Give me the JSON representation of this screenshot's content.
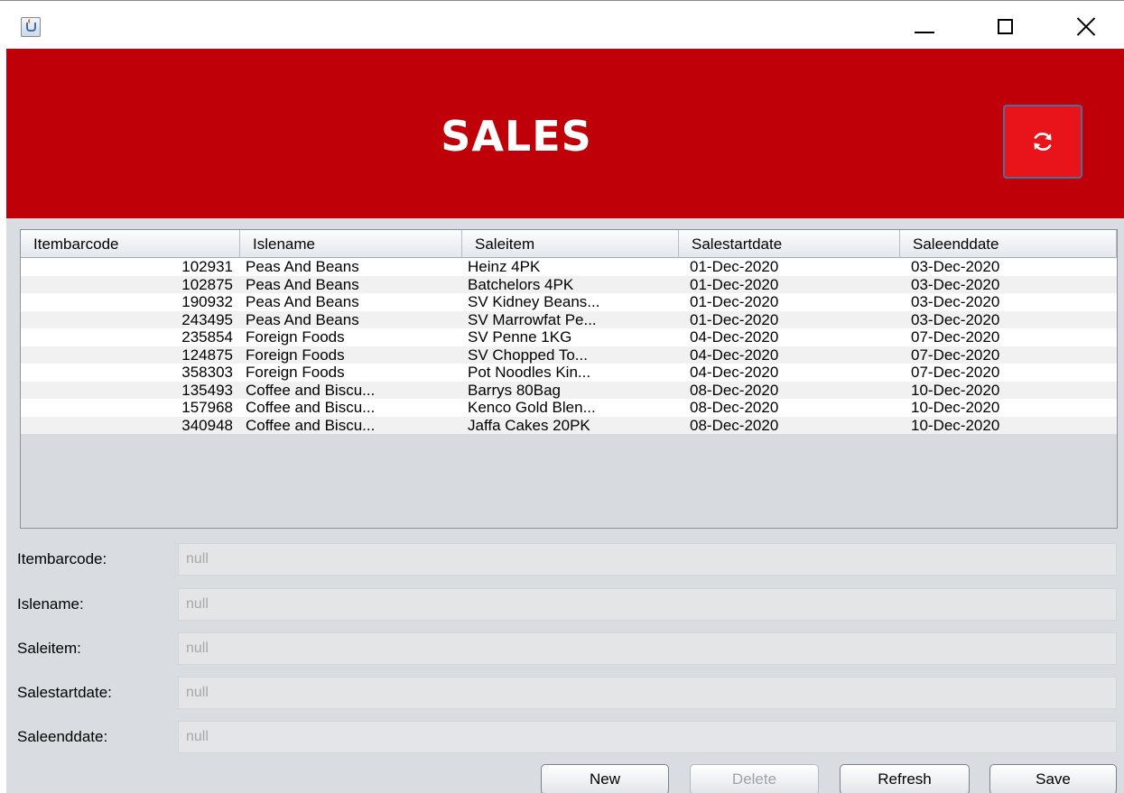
{
  "window": {
    "title": "",
    "buttons": {
      "minimize": "minimize-icon",
      "maximize": "maximize-icon",
      "close": "close-icon"
    }
  },
  "header": {
    "title": "SALES",
    "refresh_icon": "refresh-icon",
    "bg_color": "#c00008",
    "button_color": "#e8141a"
  },
  "table": {
    "columns": [
      "Itembarcode",
      "Islename",
      "Saleitem",
      "Salestartdate",
      "Saleenddate"
    ],
    "rows": [
      [
        "102931",
        "Peas And Beans",
        "Heinz 4PK",
        "01-Dec-2020",
        "03-Dec-2020"
      ],
      [
        "102875",
        "Peas And Beans",
        "Batchelors 4PK",
        "01-Dec-2020",
        "03-Dec-2020"
      ],
      [
        "190932",
        "Peas And Beans",
        "SV Kidney Beans...",
        "01-Dec-2020",
        "03-Dec-2020"
      ],
      [
        "243495",
        "Peas And Beans",
        "SV Marrowfat Pe...",
        "01-Dec-2020",
        "03-Dec-2020"
      ],
      [
        "235854",
        "Foreign Foods",
        "SV Penne 1KG",
        "04-Dec-2020",
        "07-Dec-2020"
      ],
      [
        "124875",
        "Foreign Foods",
        "SV Chopped To...",
        "04-Dec-2020",
        "07-Dec-2020"
      ],
      [
        "358303",
        "Foreign Foods",
        "Pot Noodles Kin...",
        "04-Dec-2020",
        "07-Dec-2020"
      ],
      [
        "135493",
        "Coffee and Biscu...",
        "Barrys 80Bag",
        "08-Dec-2020",
        "10-Dec-2020"
      ],
      [
        "157968",
        "Coffee and Biscu...",
        "Kenco Gold Blen...",
        "08-Dec-2020",
        "10-Dec-2020"
      ],
      [
        "340948",
        "Coffee and Biscu...",
        "Jaffa Cakes 20PK",
        "08-Dec-2020",
        "10-Dec-2020"
      ]
    ]
  },
  "form": {
    "fields": [
      {
        "label": "Itembarcode:",
        "value": "null"
      },
      {
        "label": "Islename:",
        "value": "null"
      },
      {
        "label": "Saleitem:",
        "value": "null"
      },
      {
        "label": "Salestartdate:",
        "value": "null"
      },
      {
        "label": "Saleenddate:",
        "value": "null"
      }
    ]
  },
  "buttons": {
    "new": "New",
    "delete": "Delete",
    "refresh": "Refresh",
    "save": "Save"
  }
}
